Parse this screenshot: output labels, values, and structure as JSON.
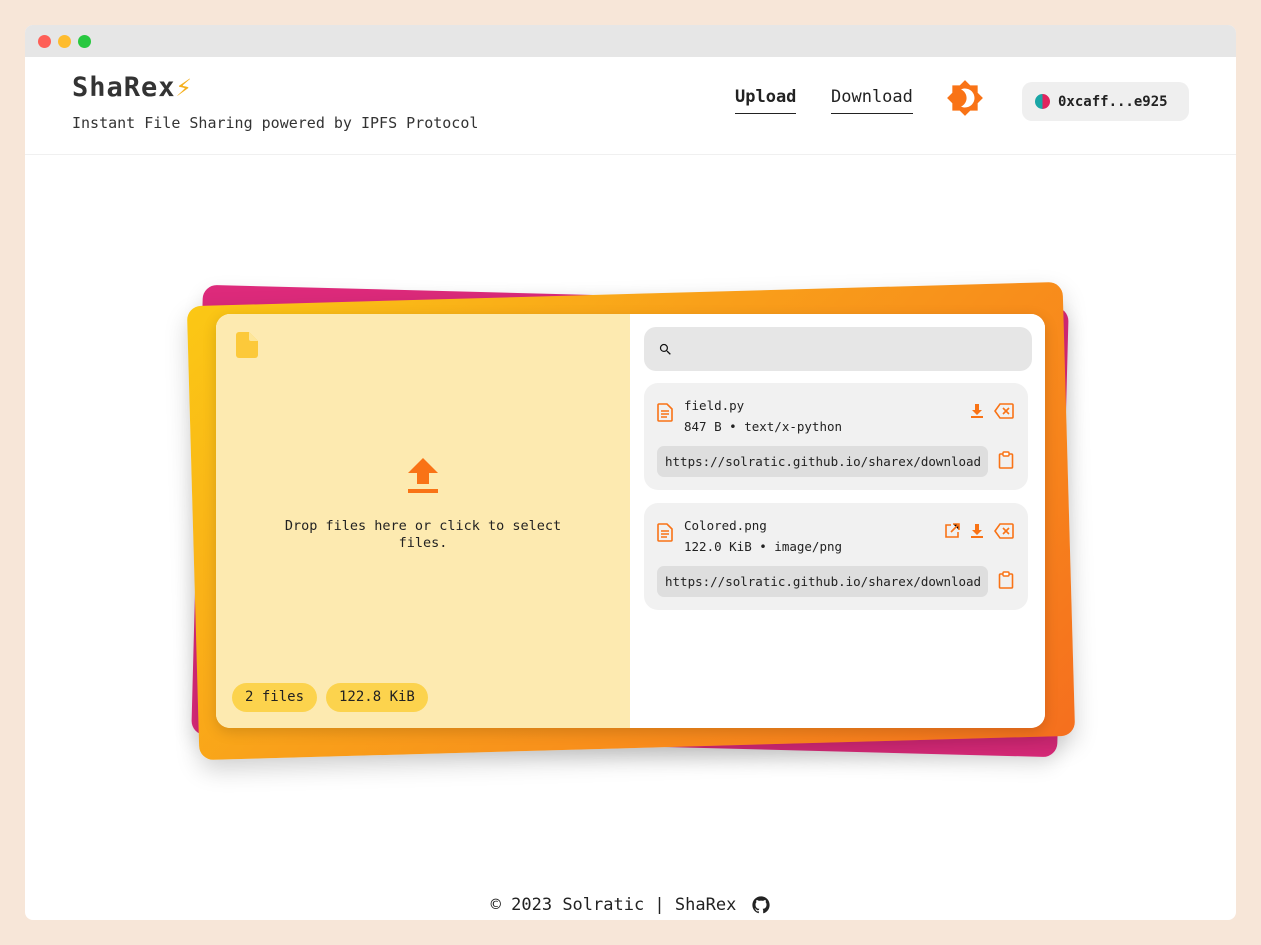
{
  "window": {
    "controls": [
      "close",
      "minimize",
      "maximize"
    ]
  },
  "header": {
    "brand": "ShaRex",
    "brand_emoji": "⚡",
    "tagline": "Instant File Sharing powered by IPFS Protocol",
    "nav": [
      {
        "label": "Upload",
        "active": true
      },
      {
        "label": "Download",
        "active": false
      }
    ],
    "theme_icon": "brightness-icon",
    "wallet": {
      "address": "0xcaff...e925"
    }
  },
  "dropzone": {
    "top_icon": "file-icon",
    "upload_icon": "upload-icon",
    "text": "Drop files here or click to select files.",
    "file_count": "2 files",
    "total_size": "122.8 KiB"
  },
  "search": {
    "icon": "search-icon",
    "placeholder": ""
  },
  "files": [
    {
      "name": "field.py",
      "meta": "847 B • text/x-python",
      "link": "https://solratic.github.io/sharex/download",
      "actions": [
        "download-icon",
        "delete-icon"
      ]
    },
    {
      "name": "Colored.png",
      "meta": "122.0 KiB • image/png",
      "link": "https://solratic.github.io/sharex/download",
      "actions": [
        "open-external-icon",
        "download-icon",
        "delete-icon"
      ]
    }
  ],
  "footer": {
    "text": "© 2023 Solratic | ShaRex",
    "icon": "github-icon"
  },
  "colors": {
    "accent": "#f97316",
    "pink": "#dd2a7b",
    "yellow": "#fbc815",
    "dropzone_bg": "#fdeab0"
  }
}
